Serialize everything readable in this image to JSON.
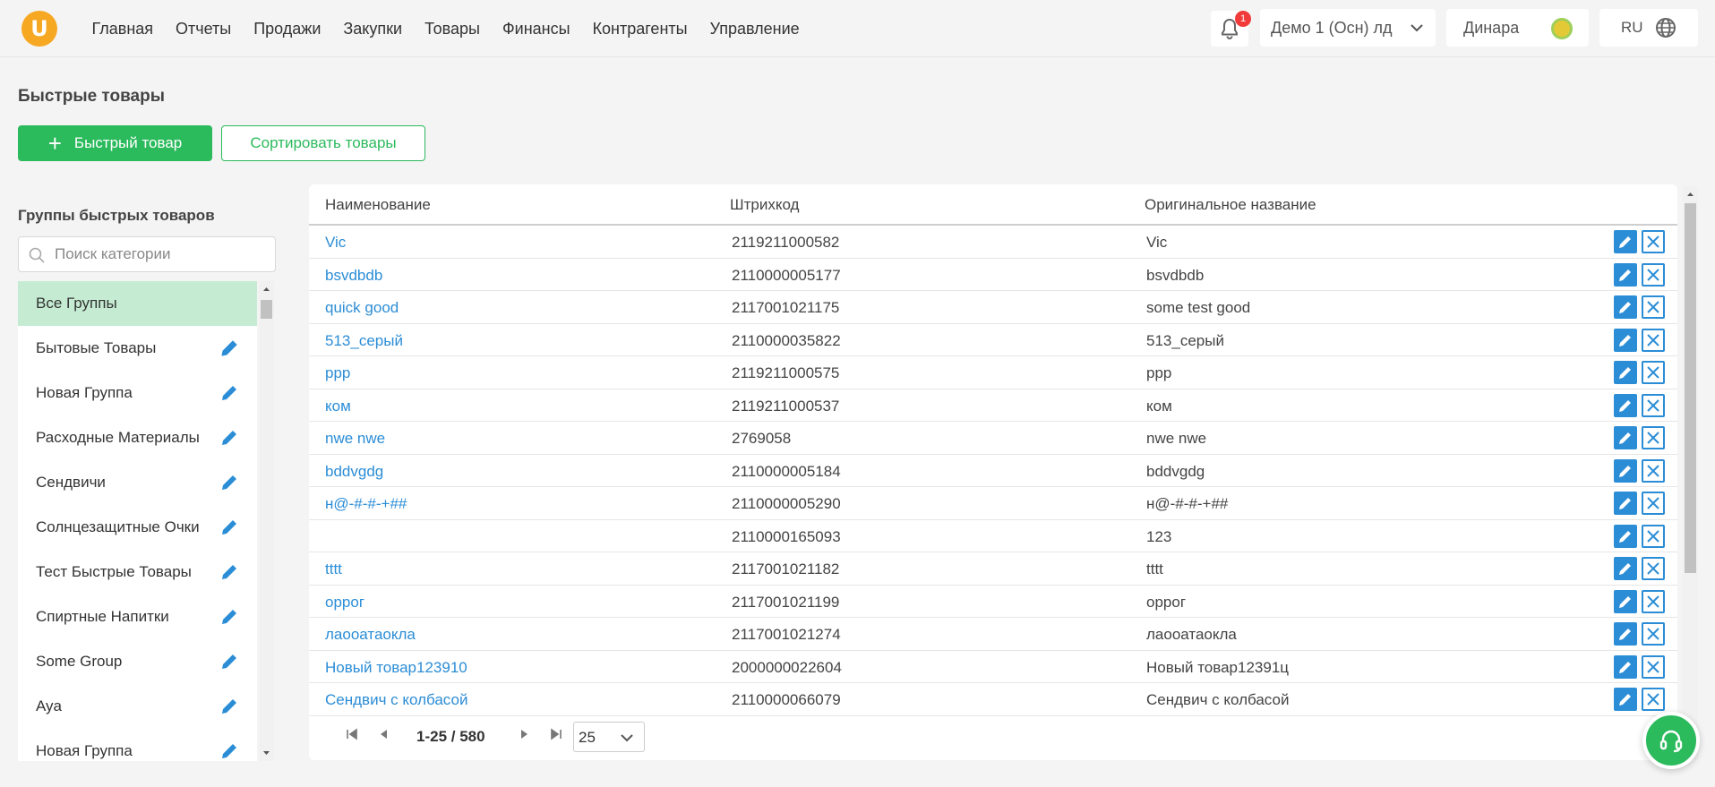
{
  "nav": {
    "items": [
      "Главная",
      "Отчеты",
      "Продажи",
      "Закупки",
      "Товары",
      "Финансы",
      "Контрагенты",
      "Управление"
    ],
    "notifications_count": "1",
    "store": "Демо 1 (Осн) лд",
    "user": "Динара",
    "language": "RU"
  },
  "page": {
    "title": "Быстрые товары",
    "add_button": "Быстрый товар",
    "sort_button": "Сортировать товары"
  },
  "groups": {
    "title": "Группы быстрых товаров",
    "search_placeholder": "Поиск категории",
    "items": [
      {
        "label": "Все Группы",
        "active": true
      },
      {
        "label": "Бытовые Товары"
      },
      {
        "label": "Новая Группа"
      },
      {
        "label": "Расходные Материалы"
      },
      {
        "label": "Сендвичи"
      },
      {
        "label": "Солнцезащитные Очки"
      },
      {
        "label": "Тест Быстрые Товары"
      },
      {
        "label": "Спиртные Напитки"
      },
      {
        "label": "Some Group"
      },
      {
        "label": "Aya"
      },
      {
        "label": "Новая Группа"
      }
    ]
  },
  "table": {
    "columns": [
      "Наименование",
      "Штрихкод",
      "Оригинальное название"
    ],
    "rows": [
      {
        "name": "Vic",
        "barcode": "2119211000582",
        "original": "Vic"
      },
      {
        "name": "bsvdbdb",
        "barcode": "2110000005177",
        "original": "bsvdbdb"
      },
      {
        "name": "quick good",
        "barcode": "2117001021175",
        "original": "some test good"
      },
      {
        "name": "513_серый",
        "barcode": "2110000035822",
        "original": "513_серый"
      },
      {
        "name": "ppp",
        "barcode": "2119211000575",
        "original": "ppp"
      },
      {
        "name": "ком",
        "barcode": "2119211000537",
        "original": "ком"
      },
      {
        "name": "nwe nwe",
        "barcode": "2769058",
        "original": "nwe nwe"
      },
      {
        "name": "bddvgdg",
        "barcode": "2110000005184",
        "original": "bddvgdg"
      },
      {
        "name": "н@-#-#-+##",
        "barcode": "2110000005290",
        "original": "н@-#-#-+##"
      },
      {
        "name": "",
        "barcode": "2110000165093",
        "original": "123"
      },
      {
        "name": "tttt",
        "barcode": "2117001021182",
        "original": "tttt"
      },
      {
        "name": "оррог",
        "barcode": "2117001021199",
        "original": "оррог"
      },
      {
        "name": "лаооатаокла",
        "barcode": "2117001021274",
        "original": "лаооатаокла"
      },
      {
        "name": "Новый товар123910",
        "barcode": "2000000022604",
        "original": "Новый товар12391ц"
      },
      {
        "name": "Сендвич с колбасой",
        "barcode": "2110000066079",
        "original": "Сендвич с колбасой"
      }
    ]
  },
  "pagination": {
    "info": "1-25 / 580",
    "page_size": "25"
  },
  "colors": {
    "accent": "#2bba5c",
    "link": "#2b8dd6",
    "logo": "#f7a823"
  }
}
